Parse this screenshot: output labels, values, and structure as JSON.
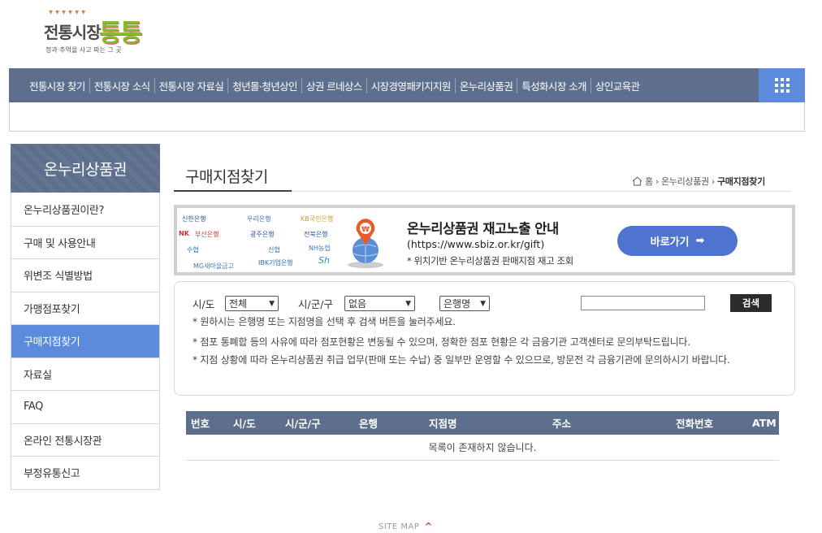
{
  "logo": {
    "title": "전통시장",
    "highlight": "통통",
    "tagline": "정과 추억을 사고 파는 그 곳"
  },
  "nav": {
    "items": [
      "전통시장 찾기",
      "전통시장 소식",
      "전통시장 자료실",
      "청년몰·청년상인",
      "상권 르네상스",
      "시장경영패키지지원",
      "온누리상품권",
      "특성화시장 소개",
      "상인교육관"
    ]
  },
  "sidebar": {
    "heading": "온누리상품권",
    "items": [
      "온누리상품권이란?",
      "구매 및 사용안내",
      "위변조 식별방법",
      "가맹점포찾기",
      "구매지점찾기",
      "자료실",
      "FAQ",
      "온라인 전통시장관",
      "부정유통신고"
    ],
    "active_index": 4
  },
  "page": {
    "title": "구매지점찾기",
    "breadcrumb": [
      "홈",
      "온누리상품권",
      "구매지점찾기"
    ]
  },
  "banner": {
    "banks": [
      "신한은행",
      "우리은행",
      "KB국민은행",
      "NK",
      "부산은행",
      "광주은행",
      "전북은행",
      "수협",
      "신협",
      "NH농협",
      "MG새마을금고",
      "IBK기업은행",
      "Sh"
    ],
    "title": "온누리상품권 재고노출 안내",
    "url": "(https://www.sbiz.or.kr/gift)",
    "desc": "* 위치기반 온누리상품권 판매지점 재고 조회",
    "button_label": "바로가기",
    "button_arrow": "➡"
  },
  "search": {
    "sido_label": "시/도",
    "sido_value": "전체",
    "sigungu_label": "시/군/구",
    "sigungu_value": "없음",
    "bank_value": "은행명",
    "input_value": "",
    "button_label": "검색",
    "notes": [
      "* 원하시는 은행명 또는 지점명을 선택 후 검색 버튼을 눌러주세요.",
      "* 점포 통폐합 등의 사유에 따라 점포현황은 변동될 수 있으며, 정확한 점포 현황은 각 금융기관 고객센터로 문의부탁드립니다.",
      "* 지점 상황에 따라 온누리상품권 취급 업무(판매 또는 수납) 중 일부만 운영할 수 있으므로, 방문전 각 금융기관에 문의하시기 바랍니다."
    ]
  },
  "table": {
    "columns": [
      "번호",
      "시/도",
      "시/군/구",
      "은행",
      "지점명",
      "주소",
      "전화번호",
      "ATM"
    ],
    "empty_message": "목록이 존재하지 않습니다."
  },
  "footer": {
    "sitemap_label": "SITE MAP",
    "sitemap_icon": "caret-up-icon"
  },
  "colors": {
    "nav_bg": "#5e6f8e",
    "accent_blue": "#5d8bdc",
    "button_blue": "#4e74cf",
    "logo_green": "#8ab833"
  }
}
